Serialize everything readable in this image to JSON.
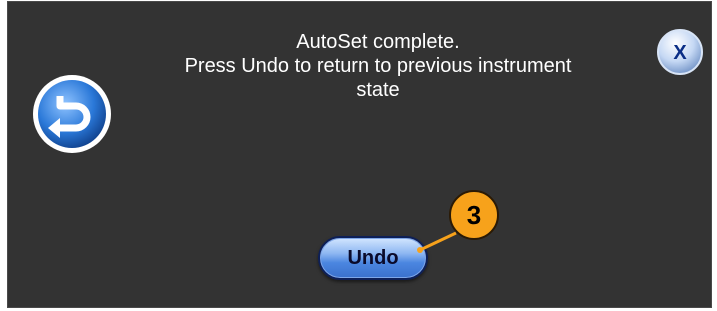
{
  "dialog": {
    "message_line1": "AutoSet complete.",
    "message_line2": "Press Undo to return to previous instrument",
    "message_line3": "state",
    "undo_label": "Undo",
    "close_label": "X"
  },
  "callout": {
    "number": "3"
  },
  "colors": {
    "dialog_bg": "#333333",
    "button_blue": "#4b86e0",
    "callout_orange": "#f7a21b"
  },
  "icons": {
    "undo_icon": "undo-arrow-icon",
    "close_icon": "close-icon"
  }
}
